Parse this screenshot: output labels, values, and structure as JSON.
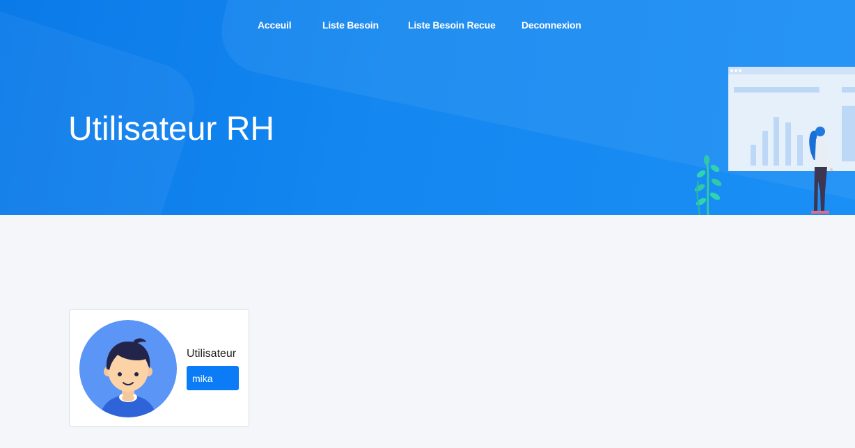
{
  "nav": {
    "items": [
      {
        "label": "Acceuil"
      },
      {
        "label": "Liste Besoin"
      },
      {
        "label": "Liste Besoin Recue"
      },
      {
        "label": "Deconnexion"
      }
    ]
  },
  "header": {
    "title": "Utilisateur RH"
  },
  "profile_card": {
    "label": "Utilisateur",
    "username": "mika"
  },
  "colors": {
    "hero_blue": "#1487f0",
    "badge_blue": "#0b7cf5",
    "avatar_bg": "#5b95f5"
  },
  "icons": {
    "avatar": "user-avatar-icon",
    "illustration": "analytics-dashboard-illustration"
  }
}
